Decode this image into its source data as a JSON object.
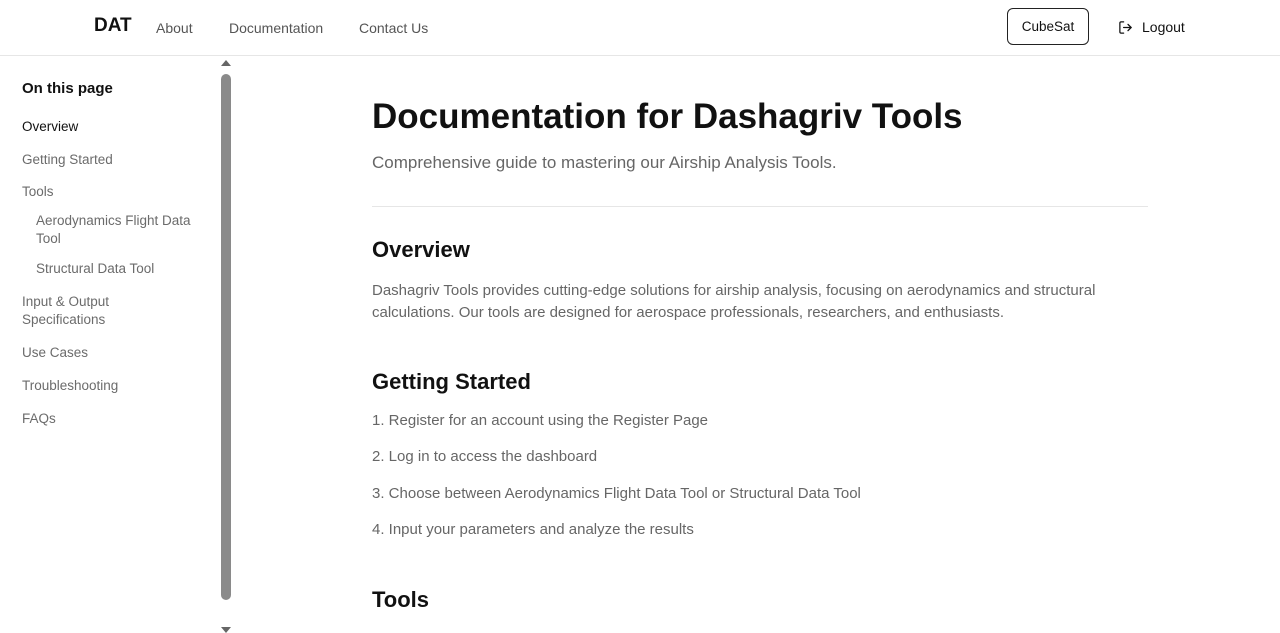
{
  "header": {
    "brand": "DAT",
    "nav": [
      "About",
      "Documentation",
      "Contact Us"
    ],
    "cubesat_label": "CubeSat",
    "logout_label": "Logout"
  },
  "sidebar": {
    "title": "On this page",
    "items": [
      {
        "label": "Overview",
        "active": true
      },
      {
        "label": "Getting Started"
      },
      {
        "label": "Tools"
      },
      {
        "label": "Aerodynamics Flight Data Tool",
        "sub": true
      },
      {
        "label": "Structural Data Tool",
        "sub": true
      },
      {
        "label": "Input & Output Specifications"
      },
      {
        "label": "Use Cases"
      },
      {
        "label": "Troubleshooting"
      },
      {
        "label": "FAQs"
      }
    ]
  },
  "main": {
    "title": "Documentation for Dashagriv Tools",
    "subtitle": "Comprehensive guide to mastering our Airship Analysis Tools.",
    "overview": {
      "heading": "Overview",
      "text": "Dashagriv Tools provides cutting-edge solutions for airship analysis, focusing on aerodynamics and structural calculations. Our tools are designed for aerospace professionals, researchers, and enthusiasts."
    },
    "getting_started": {
      "heading": "Getting Started",
      "steps": [
        "1. Register for an account using the Register Page",
        "2. Log in to access the dashboard",
        "3. Choose between Aerodynamics Flight Data Tool or Structural Data Tool",
        "4. Input your parameters and analyze the results"
      ]
    },
    "tools": {
      "heading": "Tools"
    }
  },
  "icons": {
    "logout": "logout-icon"
  }
}
